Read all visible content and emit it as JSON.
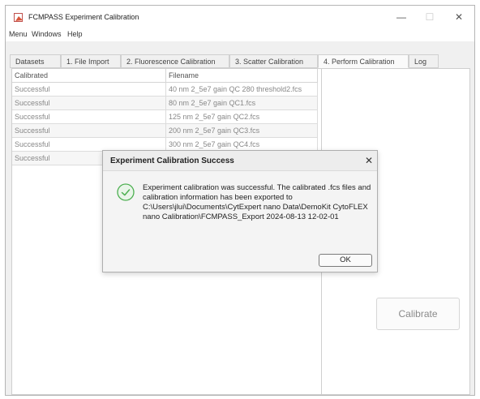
{
  "window": {
    "title": "FCMPASS Experiment Calibration",
    "controls": {
      "minimize": "—",
      "maximize": "☐",
      "close": "✕"
    }
  },
  "menu": [
    "Menu",
    "Windows",
    "Help"
  ],
  "tabs": [
    {
      "label": "Datasets",
      "active": false
    },
    {
      "label": "1. File Import",
      "active": false
    },
    {
      "label": "2. Fluorescence Calibration",
      "active": false
    },
    {
      "label": "3. Scatter Calibration",
      "active": false
    },
    {
      "label": "4. Perform Calibration",
      "active": true
    },
    {
      "label": "Log",
      "active": false
    }
  ],
  "table": {
    "columns": [
      "Calibrated",
      "Filename"
    ],
    "rows": [
      [
        "Successful",
        "40 nm 2_5e7 gain QC 280 threshold2.fcs"
      ],
      [
        "Successful",
        "80 nm 2_5e7 gain QC1.fcs"
      ],
      [
        "Successful",
        "125 nm 2_5e7 gain QC2.fcs"
      ],
      [
        "Successful",
        "200 nm 2_5e7 gain QC3.fcs"
      ],
      [
        "Successful",
        "300 nm 2_5e7 gain QC4.fcs"
      ],
      [
        "Successful",
        ""
      ]
    ]
  },
  "calibrate_button": "Calibrate",
  "dialog": {
    "title": "Experiment Calibration Success",
    "close": "✕",
    "message": "Experiment calibration was successful. The calibrated .fcs files and calibration information has been exported to C:\\Users\\jlui\\Documents\\CytExpert nano Data\\DemoKit CytoFLEX nano Calibration\\FCMPASS_Export 2024-08-13 12-02-01",
    "ok": "OK",
    "icon": "success-check-icon",
    "icon_color": "#4caf50"
  },
  "colors": {
    "window_bg": "#f0f0f0",
    "disabled_text": "#8a8a8a"
  }
}
